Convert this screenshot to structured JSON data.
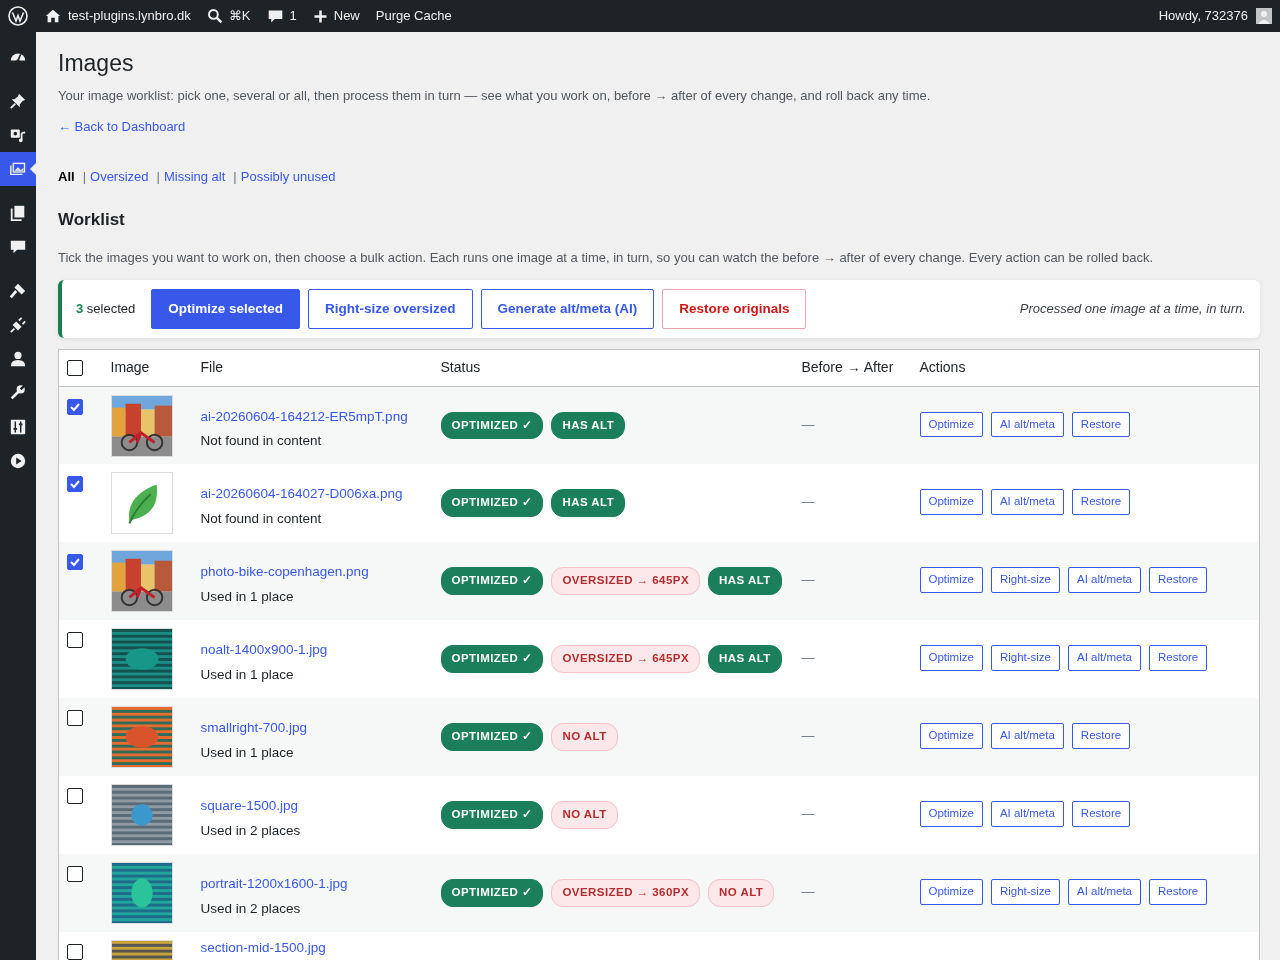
{
  "admin_bar": {
    "site": "test-plugins.lynbro.dk",
    "search_shortcut": "⌘K",
    "comments_count": "1",
    "new_label": "New",
    "purge_label": "Purge Cache",
    "greeting": "Howdy, 732376"
  },
  "sidebar": {
    "items": [
      {
        "kind": "dashboard",
        "selected": false
      },
      {
        "kind": "pin",
        "selected": false
      },
      {
        "kind": "media",
        "selected": false
      },
      {
        "kind": "images",
        "selected": true
      },
      {
        "kind": "pages",
        "selected": false
      },
      {
        "kind": "comments",
        "selected": false
      },
      {
        "kind": "brush",
        "selected": false
      },
      {
        "kind": "plug",
        "selected": false
      },
      {
        "kind": "user",
        "selected": false
      },
      {
        "kind": "wrench",
        "selected": false
      },
      {
        "kind": "sliders",
        "selected": false
      },
      {
        "kind": "play",
        "selected": false
      }
    ]
  },
  "page": {
    "title": "Images",
    "intro": "Your image worklist: pick one, several or all, then process them in turn — see what you work on, before → after of every change, and roll back any time.",
    "back_link": "← Back to Dashboard"
  },
  "filters": [
    {
      "label": "All",
      "selected": true
    },
    {
      "separator": "|",
      "label": "Oversized",
      "selected": false
    },
    {
      "separator": "|",
      "label": "Missing alt",
      "selected": false
    },
    {
      "separator": "|",
      "label": "Possibly unused",
      "selected": false
    }
  ],
  "worklist": {
    "heading": "Worklist",
    "description": "Tick the images you want to work on, then choose a bulk action. Each runs one image at a time, in turn, so you can watch the before → after of every change. Every action can be rolled back.",
    "selected_count": "3",
    "selected_label": "selected",
    "bulk_actions": [
      {
        "label": "Optimize selected",
        "kind": "primary"
      },
      {
        "label": "Right-size oversized",
        "kind": "outline"
      },
      {
        "label": "Generate alt/meta (AI)",
        "kind": "outline"
      },
      {
        "label": "Restore originals",
        "kind": "danger"
      }
    ],
    "note": "Processed one image at a time, in turn."
  },
  "table": {
    "columns": [
      "Image",
      "File",
      "Status",
      "Before → After",
      "Actions"
    ],
    "select_all_checked": false,
    "rows": [
      {
        "checked": true,
        "file": "ai-20260604-164212-ER5mpT.png",
        "usage": "Not found in content",
        "badges": [
          {
            "label": "OPTIMIZED ✓",
            "kind": "success"
          },
          {
            "label": "HAS ALT",
            "kind": "success"
          }
        ],
        "before_after": "—",
        "actions": [
          "Optimize",
          "AI alt/meta",
          "Restore"
        ]
      },
      {
        "checked": true,
        "file": "ai-20260604-164027-D006xa.png",
        "usage": "Not found in content",
        "badges": [
          {
            "label": "OPTIMIZED ✓",
            "kind": "success"
          },
          {
            "label": "HAS ALT",
            "kind": "success"
          }
        ],
        "before_after": "—",
        "actions": [
          "Optimize",
          "AI alt/meta",
          "Restore"
        ]
      },
      {
        "checked": true,
        "file": "photo-bike-copenhagen.png",
        "usage": "Used in 1 place",
        "badges": [
          {
            "label": "OPTIMIZED ✓",
            "kind": "success"
          },
          {
            "label": "OVERSIZED → 645PX",
            "kind": "warning"
          },
          {
            "label": "HAS ALT",
            "kind": "success"
          }
        ],
        "before_after": "—",
        "actions": [
          "Optimize",
          "Right-size",
          "AI alt/meta",
          "Restore"
        ]
      },
      {
        "checked": false,
        "file": "noalt-1400x900-1.jpg",
        "usage": "Used in 1 place",
        "badges": [
          {
            "label": "OPTIMIZED ✓",
            "kind": "success"
          },
          {
            "label": "OVERSIZED → 645PX",
            "kind": "warning"
          },
          {
            "label": "HAS ALT",
            "kind": "success"
          }
        ],
        "before_after": "—",
        "actions": [
          "Optimize",
          "Right-size",
          "AI alt/meta",
          "Restore"
        ]
      },
      {
        "checked": false,
        "file": "smallright-700.jpg",
        "usage": "Used in 1 place",
        "badges": [
          {
            "label": "OPTIMIZED ✓",
            "kind": "success"
          },
          {
            "label": "NO ALT",
            "kind": "warning"
          }
        ],
        "before_after": "—",
        "actions": [
          "Optimize",
          "AI alt/meta",
          "Restore"
        ]
      },
      {
        "checked": false,
        "file": "square-1500.jpg",
        "usage": "Used in 2 places",
        "badges": [
          {
            "label": "OPTIMIZED ✓",
            "kind": "success"
          },
          {
            "label": "NO ALT",
            "kind": "warning"
          }
        ],
        "before_after": "—",
        "actions": [
          "Optimize",
          "AI alt/meta",
          "Restore"
        ]
      },
      {
        "checked": false,
        "file": "portrait-1200x1600-1.jpg",
        "usage": "Used in 2 places",
        "badges": [
          {
            "label": "OPTIMIZED ✓",
            "kind": "success"
          },
          {
            "label": "OVERSIZED → 360PX",
            "kind": "warning"
          },
          {
            "label": "NO ALT",
            "kind": "warning"
          }
        ],
        "before_after": "—",
        "actions": [
          "Optimize",
          "Right-size",
          "AI alt/meta",
          "Restore"
        ]
      },
      {
        "checked": false,
        "file": "section-mid-1500.jpg"
      }
    ]
  }
}
